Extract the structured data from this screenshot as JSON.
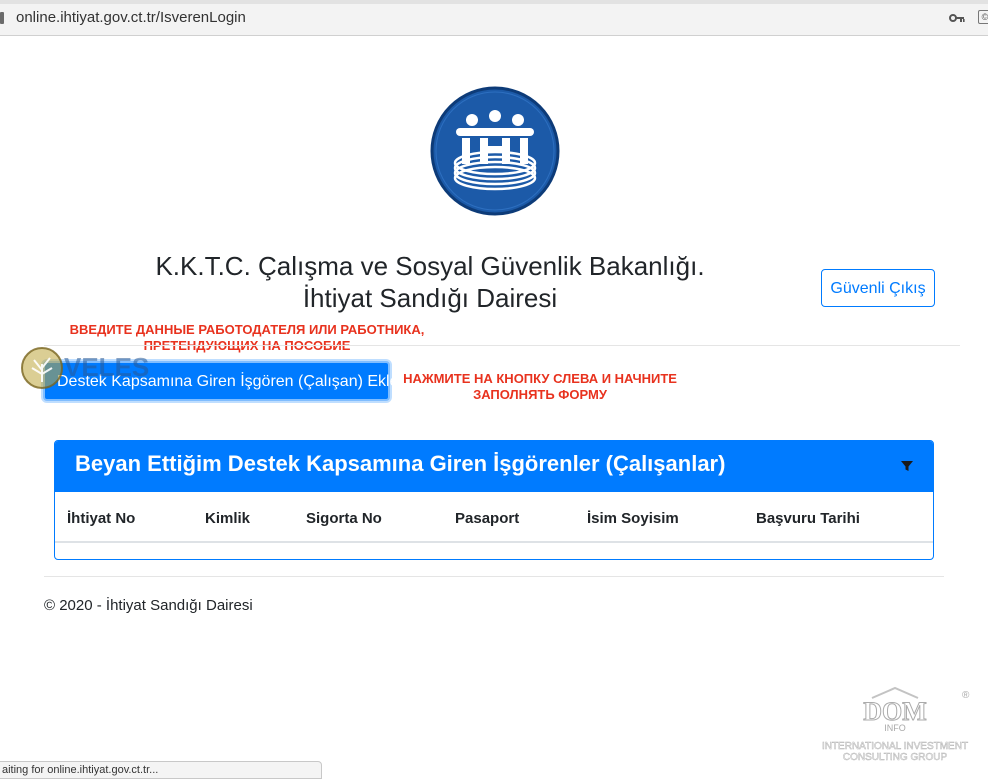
{
  "browser": {
    "url": "online.ihtiyat.gov.ct.tr/IsverenLogin",
    "status_text": "aiting for online.ihtiyat.gov.ct.tr..."
  },
  "header": {
    "title_line1": "K.K.T.C. Çalışma ve Sosyal Güvenlik Bakanlığı.",
    "title_line2": "İhtiyat Sandığı Dairesi",
    "logout_label": "Güvenli Çıkış"
  },
  "annotations": {
    "note_top_line1": "ВВЕДИТЕ ДАННЫЕ РАБОТОДАТЕЛЯ ИЛИ РАБОТНИКА,",
    "note_top_line2": "ПРЕТЕНДУЮЩИХ НА ПОСОБИЕ",
    "note_right_line1": "НАЖМИТЕ НА КНОПКУ СЛЕВА И НАЧНИТЕ",
    "note_right_line2": "ЗАПОЛНЯТЬ ФОРМУ"
  },
  "actions": {
    "add_employee_label": "Destek Kapsamına Giren İşgören (Çalışan) Ekle"
  },
  "table": {
    "title": "Beyan Ettiğim Destek Kapsamına Giren İşgörenler (Çalışanlar)",
    "columns": [
      "İhtiyat No",
      "Kimlik",
      "Sigorta No",
      "Pasaport",
      "İsim Soyisim",
      "Başvuru Tarihi"
    ],
    "rows": []
  },
  "footer": {
    "copyright": "© 2020 - İhtiyat Sandığı Dairesi"
  },
  "watermarks": {
    "veles": "VELES",
    "dom": "DOM",
    "dom_sub": "INFO",
    "dom_tagline1": "INTERNATIONAL INVESTMENT",
    "dom_tagline2": "CONSULTING GROUP"
  },
  "colors": {
    "primary": "#007bff",
    "annotation_red": "#e8321e",
    "logo_blue": "#1c5aa8"
  }
}
